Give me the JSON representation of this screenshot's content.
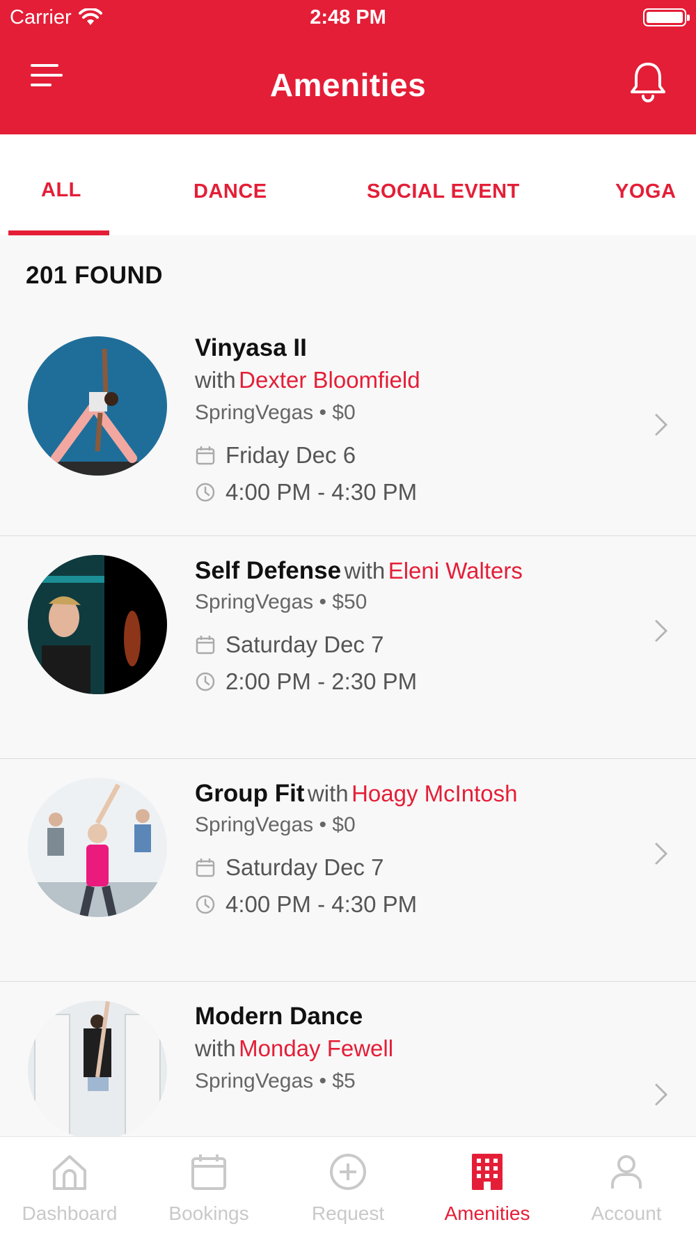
{
  "colors": {
    "brand": "#e41e37"
  },
  "status": {
    "carrier": "Carrier",
    "time": "2:48 PM"
  },
  "header": {
    "title": "Amenities",
    "menu_icon": "menu-icon",
    "bell_icon": "bell-icon"
  },
  "tabs": [
    {
      "label": "ALL",
      "active": true
    },
    {
      "label": "DANCE"
    },
    {
      "label": "SOCIAL EVENT"
    },
    {
      "label": "YOGA"
    }
  ],
  "found": "201 FOUND",
  "items": [
    {
      "title": "Vinyasa II",
      "with": "with",
      "instructor": "Dexter Bloomfield",
      "meta": "SpringVegas • $0",
      "date": "Friday Dec 6",
      "time": "4:00 PM - 4:30 PM"
    },
    {
      "title": "Self Defense",
      "with": "with",
      "instructor": "Eleni Walters",
      "meta": "SpringVegas • $50",
      "date": "Saturday Dec 7",
      "time": "2:00 PM - 2:30 PM"
    },
    {
      "title": "Group Fit",
      "with": "with",
      "instructor": "Hoagy McIntosh",
      "meta": "SpringVegas • $0",
      "date": "Saturday Dec 7",
      "time": "4:00 PM - 4:30 PM"
    },
    {
      "title": "Modern Dance",
      "with": "with",
      "instructor": "Monday Fewell",
      "meta": "SpringVegas • $5"
    }
  ],
  "tabbar": [
    {
      "label": "Dashboard",
      "icon": "home-icon"
    },
    {
      "label": "Bookings",
      "icon": "calendar-icon"
    },
    {
      "label": "Request",
      "icon": "plus-circle-icon"
    },
    {
      "label": "Amenities",
      "icon": "building-icon",
      "active": true
    },
    {
      "label": "Account",
      "icon": "person-icon"
    }
  ]
}
